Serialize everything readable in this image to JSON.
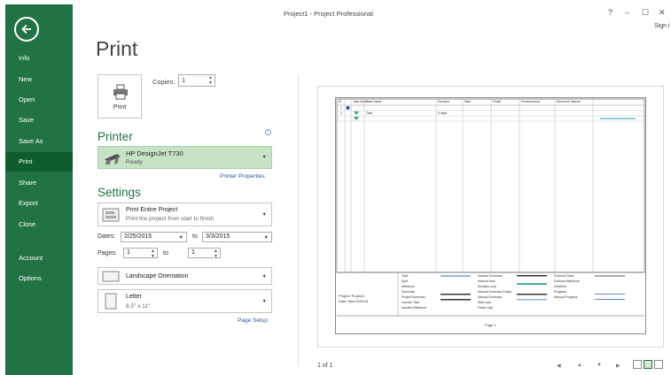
{
  "window": {
    "title": "Project1 - Project Professional",
    "help": "?",
    "minimize": "–",
    "restore": "☐",
    "close": "✕",
    "sign_in": "Sign i"
  },
  "sidebar": {
    "items": [
      {
        "label": "Info"
      },
      {
        "label": "New"
      },
      {
        "label": "Open"
      },
      {
        "label": "Save"
      },
      {
        "label": "Save As"
      },
      {
        "label": "Print",
        "active": true
      },
      {
        "label": "Share"
      },
      {
        "label": "Export"
      },
      {
        "label": "Close"
      },
      {
        "label": "Account"
      },
      {
        "label": "Options"
      }
    ]
  },
  "print": {
    "heading": "Print",
    "print_button": "Print",
    "copies_label": "Copies:",
    "copies_value": "1"
  },
  "printer": {
    "heading": "Printer",
    "name": "HP DesignJet T730",
    "status": "Ready",
    "properties_link": "Printer Properties"
  },
  "settings": {
    "heading": "Settings",
    "scope_title": "Print Entire Project",
    "scope_desc": "Print the project from start to finish",
    "dates_label": "Dates:",
    "date_from": "2/25/2015",
    "to_label": "to",
    "date_to": "3/3/2015",
    "pages_label": "Pages:",
    "page_from": "1",
    "page_to_label": "to",
    "page_to": "1",
    "orientation": "Landscape Orientation",
    "paper_name": "Letter",
    "paper_size": "8.5\" x 11\"",
    "page_setup_link": "Page Setup"
  },
  "preview": {
    "page_info": "1 of 1",
    "table_headers": [
      "ID",
      "",
      "Task Mode",
      "Task Name",
      "Duration",
      "Start",
      "Finish",
      "Predecessors",
      "Resource Names"
    ],
    "rows": [
      {
        "id": "1",
        "name": ""
      },
      {
        "id": "2",
        "name": "Task",
        "duration": "5 days"
      }
    ],
    "legend_project": "Project: Project1",
    "legend_date": "Date: Wed 2/25/15",
    "legend_col1": [
      "Task",
      "Split",
      "Milestone",
      "Summary",
      "Project Summary",
      "Inactive Task",
      "Inactive Milestone"
    ],
    "legend_col2": [
      "Inactive Summary",
      "Manual Task",
      "Duration-only",
      "Manual Summary Rollup",
      "Manual Summary",
      "Start-only",
      "Finish-only"
    ],
    "legend_col3": [
      "External Tasks",
      "External Milestone",
      "Deadline",
      "Progress",
      "Manual Progress"
    ],
    "footer": "Page 1"
  }
}
